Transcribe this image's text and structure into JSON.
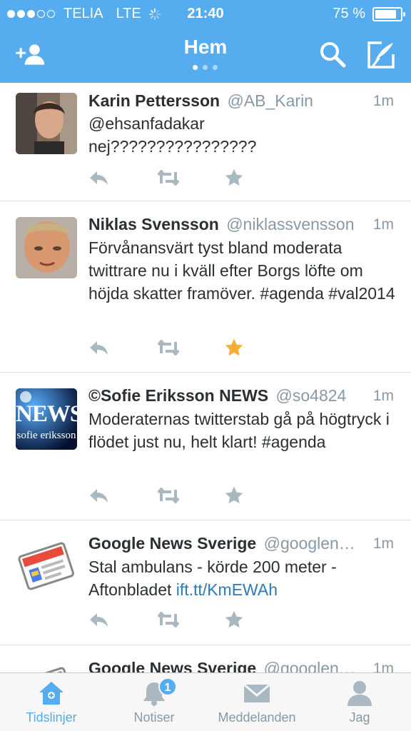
{
  "status_bar": {
    "carrier": "TELIA",
    "network": "LTE",
    "time": "21:40",
    "battery": "75 %",
    "battery_level": 0.75
  },
  "header": {
    "title": "Hem",
    "page_count": 3,
    "active_page": 1,
    "left_icon": "add-user-icon",
    "right_icons": [
      "search-icon",
      "compose-icon"
    ]
  },
  "tweets": [
    {
      "name": "Karin Pettersson",
      "handle": "@AB_Karin",
      "time": "1m",
      "text": "@ehsanfadakar nej????????????????",
      "favorited": false
    },
    {
      "name": "Niklas Svensson",
      "handle": "@niklassvensson",
      "time": "1m",
      "text": "Förvånansvärt tyst bland moderata twittrare nu i kväll efter Borgs löfte om höjda skatter framöver. #agenda #val2014",
      "favorited": true
    },
    {
      "name": "©Sofie Eriksson NEWS",
      "handle": "@so4824",
      "time": "1m",
      "text": "Moderaternas twitterstab gå på högtryck i flödet just nu, helt klart! #agenda",
      "favorited": false,
      "avatar_text_top": "NEWS",
      "avatar_text_bottom": "sofie eriksson"
    },
    {
      "name": "Google News Sverige",
      "handle": "@googlen…",
      "time": "1m",
      "text": "Stal ambulans - körde 200 meter - Aftonbladet ",
      "link": "ift.tt/KmEWAh",
      "favorited": false
    },
    {
      "name": "Google News Sverige",
      "handle": "@googlen…",
      "time": "1m"
    }
  ],
  "tabs": [
    {
      "label": "Tidslinjer",
      "icon": "home-icon",
      "active": true
    },
    {
      "label": "Notiser",
      "icon": "bell-icon",
      "badge": "1"
    },
    {
      "label": "Meddelanden",
      "icon": "envelope-icon"
    },
    {
      "label": "Jag",
      "icon": "person-icon"
    }
  ],
  "colors": {
    "accent": "#55acee",
    "favorite": "#ffac33",
    "action_gray": "#aab8c2",
    "link": "#2b7bb9"
  }
}
